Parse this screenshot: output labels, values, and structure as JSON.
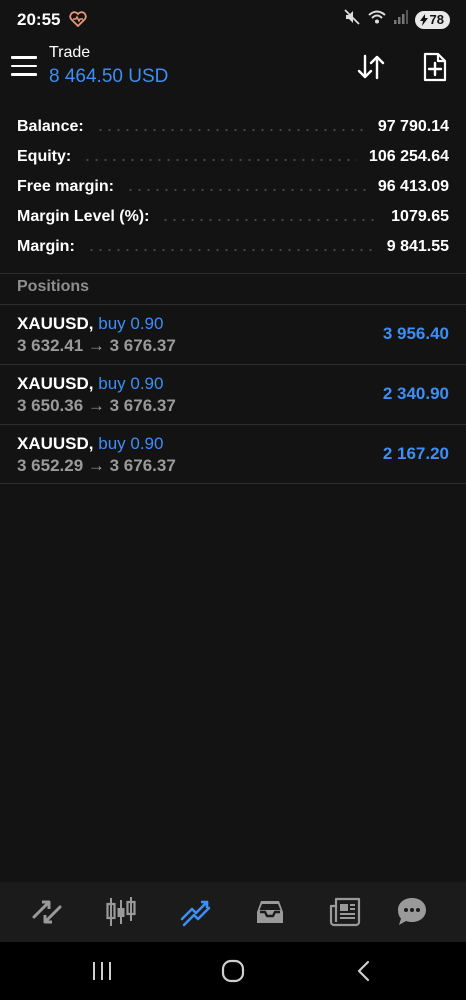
{
  "status_bar": {
    "time": "20:55",
    "battery": "78"
  },
  "header": {
    "title": "Trade",
    "balance": "8 464.50 USD"
  },
  "summary": [
    {
      "label": "Balance:",
      "value": "97 790.14"
    },
    {
      "label": "Equity:",
      "value": "106 254.64"
    },
    {
      "label": "Free margin:",
      "value": "96 413.09"
    },
    {
      "label": "Margin Level (%):",
      "value": "1079.65"
    },
    {
      "label": "Margin:",
      "value": "9 841.55"
    }
  ],
  "positions": {
    "header": "Positions",
    "items": [
      {
        "symbol": "XAUUSD,",
        "side": "buy 0.90",
        "prices": "3 632.41 → 3 676.37",
        "profit": "3 956.40"
      },
      {
        "symbol": "XAUUSD,",
        "side": "buy 0.90",
        "prices": "3 650.36 → 3 676.37",
        "profit": "2 340.90"
      },
      {
        "symbol": "XAUUSD,",
        "side": "buy 0.90",
        "prices": "3 652.29 → 3 676.37",
        "profit": "2 167.20"
      }
    ]
  },
  "tabs": [
    {
      "icon": "quotes-arrows-icon",
      "active": false
    },
    {
      "icon": "chart-candles-icon",
      "active": false
    },
    {
      "icon": "trade-icon",
      "active": true
    },
    {
      "icon": "history-inbox-icon",
      "active": false
    },
    {
      "icon": "news-icon",
      "active": false
    },
    {
      "icon": "chat-icon",
      "active": false
    }
  ],
  "colors": {
    "accent": "#3d8ef5",
    "background": "#131313",
    "muted": "#8e8e8e"
  }
}
